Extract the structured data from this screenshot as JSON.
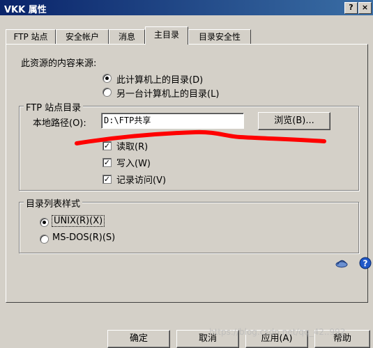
{
  "window": {
    "title": "VKK 属性",
    "help_btn": "?",
    "close_btn": "×"
  },
  "tabs": [
    {
      "label": "FTP 站点",
      "active": false
    },
    {
      "label": "安全帐户",
      "active": false
    },
    {
      "label": "消息",
      "active": false
    },
    {
      "label": "主目录",
      "active": true
    },
    {
      "label": "目录安全性",
      "active": false
    }
  ],
  "content_source": {
    "label": "此资源的内容来源:",
    "options": [
      {
        "label": "此计算机上的目录(D)",
        "selected": true
      },
      {
        "label": "另一台计算机上的目录(L)",
        "selected": false
      }
    ]
  },
  "ftp_dir": {
    "legend": "FTP 站点目录",
    "path_label": "本地路径(O):",
    "path_value": "D:\\FTP共享",
    "browse_label": "浏览(B)...",
    "permissions": [
      {
        "label": "读取(R)",
        "checked": true
      },
      {
        "label": "写入(W)",
        "checked": true
      },
      {
        "label": "记录访问(V)",
        "checked": true
      }
    ]
  },
  "listing_style": {
    "legend": "目录列表样式",
    "options": [
      {
        "label": "UNIX(R)(X)",
        "selected": true
      },
      {
        "label": "MS-DOS(R)(S)",
        "selected": false
      }
    ]
  },
  "footer": {
    "ok": "确定",
    "cancel": "取消",
    "apply": "应用(A)",
    "help": "帮助"
  },
  "watermark": "https://blog.csdn.net/qq_42..992",
  "annotation_color": "#ff0000",
  "icons": [
    "dish-icon",
    "help-circle-icon"
  ]
}
